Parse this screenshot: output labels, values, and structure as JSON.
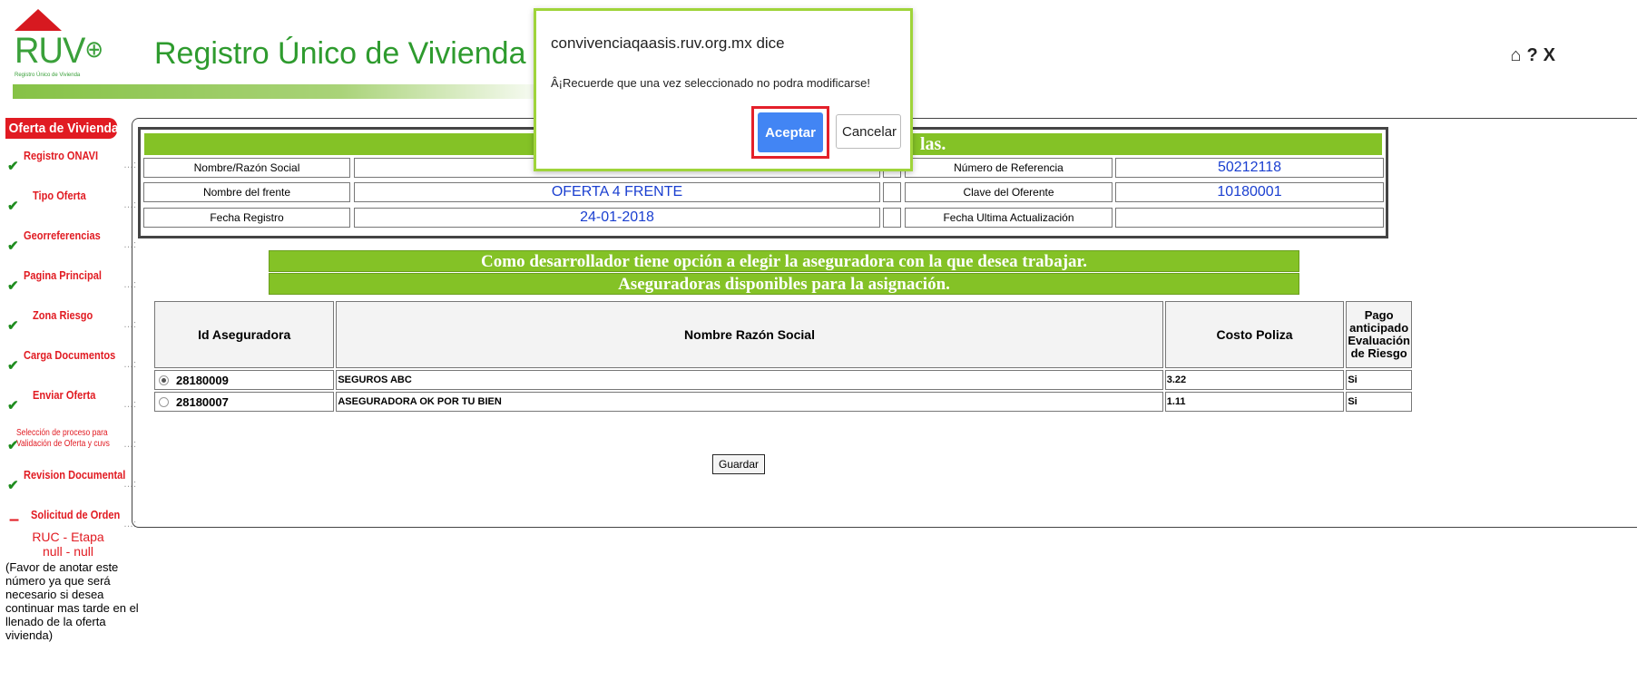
{
  "header": {
    "logo_text": "RUV",
    "logo_sub": "Registro Único de Vivienda",
    "title": "Registro Único de Vivienda",
    "icons": [
      "home-icon",
      "help-icon",
      "close-icon"
    ],
    "home_glyph": "⌂",
    "help_glyph": "?",
    "close_glyph": "X"
  },
  "sidebar": {
    "heading": "Oferta de Vivienda",
    "items": [
      {
        "label": "Registro ONAVI",
        "status": "done"
      },
      {
        "label": "Tipo Oferta",
        "status": "done"
      },
      {
        "label": "Georreferencias",
        "status": "done"
      },
      {
        "label": "Pagina Principal",
        "status": "done"
      },
      {
        "label": "Zona Riesgo",
        "status": "done"
      },
      {
        "label": "Carga Documentos",
        "status": "done"
      },
      {
        "label": "Enviar Oferta",
        "status": "done"
      },
      {
        "label_line1": "Selección de proceso para",
        "label_line2": "Validación de Oferta y cuvs",
        "status": "done"
      },
      {
        "label": "Revision Documental",
        "status": "done"
      },
      {
        "label": "Solicitud de Orden",
        "status": "current"
      }
    ],
    "ruc_label": "RUC - Etapa",
    "ruc_value": "null - null",
    "note": "(Favor de anotar este número ya que será necesario si desea continuar mas tarde en el llenado de la oferta vivienda)"
  },
  "info": {
    "header_text": "las.",
    "rows": [
      {
        "label": "Nombre/Razón Social",
        "value": "",
        "label2": "Número de Referencia",
        "value2": "50212118"
      },
      {
        "label": "Nombre del frente",
        "value": "OFERTA 4 FRENTE",
        "label2": "Clave del Oferente",
        "value2": "10180001"
      },
      {
        "label": "Fecha Registro",
        "value": "24-01-2018",
        "label2": "Fecha Ultima Actualización",
        "value2": ""
      }
    ]
  },
  "banner1": "Como desarrollador tiene opción a elegir la aseguradora con la que desea trabajar.",
  "banner2": "Aseguradoras disponibles para la asignación.",
  "insurers": {
    "columns": [
      "Id Aseguradora",
      "Nombre Razón Social",
      "Costo Poliza",
      "Pago anticipado Evaluación de Riesgo"
    ],
    "rows": [
      {
        "id": "28180009",
        "name": "SEGUROS ABC",
        "cost": "3.22",
        "pago": "Si",
        "selected": true
      },
      {
        "id": "28180007",
        "name": "ASEGURADORA OK POR TU BIEN",
        "cost": "1.11",
        "pago": "Si",
        "selected": false
      }
    ]
  },
  "save_label": "Guardar",
  "dialog": {
    "title": "convivenciaqaasis.ruv.org.mx dice",
    "message": "Â¡Recuerde que una vez seleccionado no podra modificarse!",
    "ok_label": "Aceptar",
    "cancel_label": "Cancelar"
  },
  "colors": {
    "brand_green": "#84c226",
    "accent_red": "#e11b22",
    "link_blue": "#1a3fd0",
    "dialog_button": "#4285f4"
  }
}
